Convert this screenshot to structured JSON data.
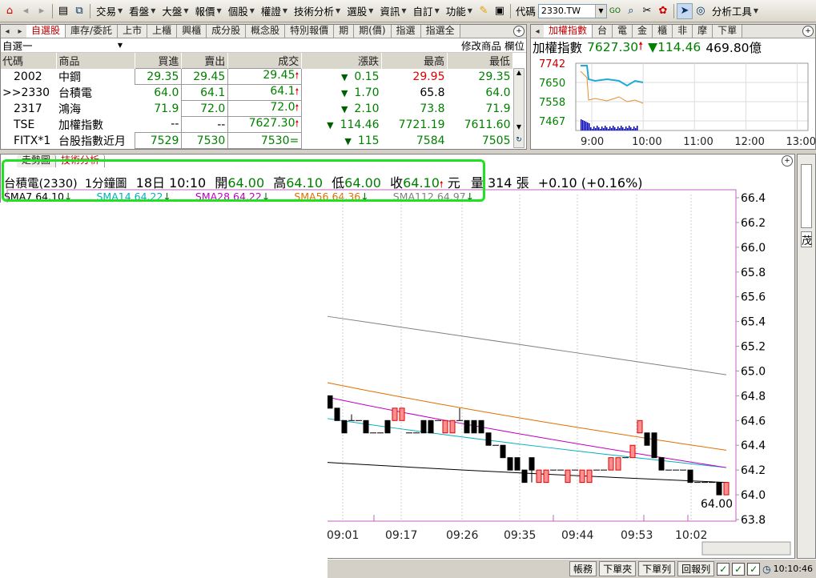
{
  "toolbar": {
    "menus": [
      "交易",
      "看盤",
      "大盤",
      "報價",
      "個股",
      "權證",
      "技術分析",
      "選股",
      "資訊",
      "自訂",
      "功能"
    ],
    "code_label": "代碼",
    "code_value": "2330.TW",
    "tools_label": "分析工具"
  },
  "watch": {
    "tabs": [
      "自選股",
      "庫存/委託",
      "上市",
      "上櫃",
      "興櫃",
      "成分股",
      "概念股",
      "特別報價",
      "期",
      "期(價)",
      "指選",
      "指選全"
    ],
    "group": "自選一",
    "modify_label": "修改商品",
    "field_label": "欄位",
    "columns": [
      "代碼",
      "商品",
      "買進",
      "賣出",
      "成交",
      "漲跌",
      "最高",
      "最低"
    ],
    "rows": [
      {
        "code": "2002",
        "name": "中鋼",
        "bid": "29.35",
        "ask": "29.45",
        "last": "29.45",
        "chg": "0.15",
        "high": "29.95",
        "low": "29.35"
      },
      {
        "code": ">>2330",
        "name": "台積電",
        "bid": "64.0",
        "ask": "64.1",
        "last": "64.1",
        "chg": "1.70",
        "high": "65.8",
        "low": "64.0"
      },
      {
        "code": "2317",
        "name": "鴻海",
        "bid": "71.9",
        "ask": "72.0",
        "last": "72.0",
        "chg": "2.10",
        "high": "73.8",
        "low": "71.9"
      },
      {
        "code": "TSE",
        "name": "加權指數",
        "bid": "--",
        "ask": "--",
        "last": "7627.30",
        "chg": "114.46",
        "high": "7721.19",
        "low": "7611.60"
      },
      {
        "code": "FITX*1",
        "name": "台股指數近月",
        "bid": "7529",
        "ask": "7530",
        "last": "7530=",
        "chg": "115",
        "high": "7584",
        "low": "7505"
      }
    ]
  },
  "mini": {
    "tabs": [
      "加權指數",
      "台",
      "電",
      "金",
      "櫃",
      "非",
      "摩",
      "下單"
    ],
    "index_name": "加權指數",
    "index_value": "7627.30",
    "index_change": "114.46",
    "volume": "469.80億",
    "y_ticks": [
      "7742",
      "7650",
      "7558",
      "7467"
    ],
    "x_ticks": [
      "9:00",
      "10:00",
      "11:00",
      "12:00",
      "13:00"
    ]
  },
  "chart": {
    "tabs": [
      "走勢圖",
      "技術分析"
    ],
    "stock": "台積電(2330)",
    "period": "1分鐘圖",
    "date_time": "18日 10:10",
    "open_label": "開",
    "open": "64.00",
    "high_label": "高",
    "high": "64.10",
    "low_label": "低",
    "low": "64.00",
    "close_label": "收",
    "close": "64.10",
    "unit": "元",
    "vol_label": "量",
    "vol": "314",
    "vol_unit": "張",
    "change": "+0.10 (+0.16%)",
    "sma": [
      {
        "label": "SMA7 64.10",
        "color": "#000000"
      },
      {
        "label": "SMA14 64.22",
        "color": "#00b0c0"
      },
      {
        "label": "SMA28 64.22",
        "color": "#c000c0"
      },
      {
        "label": "SMA56 64.36",
        "color": "#e07000"
      },
      {
        "label": "SMA112 64.97",
        "color": "#808080"
      }
    ],
    "last_price_label": "64.00",
    "side_label": "茂"
  },
  "chart_data": {
    "type": "candlestick",
    "y_ticks": [
      66.4,
      66.2,
      66.0,
      65.8,
      65.6,
      65.4,
      65.2,
      65.0,
      64.8,
      64.6,
      64.4,
      64.2,
      64.0,
      63.8
    ],
    "ylim": [
      63.8,
      66.4
    ],
    "x_ticks": [
      "09:01",
      "09:17",
      "09:26",
      "09:35",
      "09:44",
      "09:53",
      "10:02"
    ],
    "candles": [
      {
        "o": 64.8,
        "c": 64.7,
        "h": 64.8,
        "l": 64.7
      },
      {
        "o": 64.7,
        "c": 64.6,
        "h": 64.7,
        "l": 64.6
      },
      {
        "o": 64.6,
        "c": 64.5,
        "h": 64.6,
        "l": 64.5
      },
      {
        "o": 64.6,
        "c": 64.6,
        "h": 64.65,
        "l": 64.6
      },
      {
        "o": 64.6,
        "c": 64.6,
        "h": 64.6,
        "l": 64.6
      },
      {
        "o": 64.6,
        "c": 64.5,
        "h": 64.6,
        "l": 64.5
      },
      {
        "o": 64.5,
        "c": 64.5,
        "h": 64.5,
        "l": 64.5
      },
      {
        "o": 64.5,
        "c": 64.5,
        "h": 64.5,
        "l": 64.5
      },
      {
        "o": 64.6,
        "c": 64.5,
        "h": 64.6,
        "l": 64.5
      },
      {
        "o": 64.6,
        "c": 64.7,
        "h": 64.7,
        "l": 64.6
      },
      {
        "o": 64.6,
        "c": 64.7,
        "h": 64.7,
        "l": 64.6
      },
      {
        "o": 64.5,
        "c": 64.5,
        "h": 64.5,
        "l": 64.5
      },
      {
        "o": 64.5,
        "c": 64.5,
        "h": 64.5,
        "l": 64.5
      },
      {
        "o": 64.6,
        "c": 64.5,
        "h": 64.6,
        "l": 64.5
      },
      {
        "o": 64.6,
        "c": 64.5,
        "h": 64.6,
        "l": 64.5
      },
      {
        "o": 64.6,
        "c": 64.6,
        "h": 64.6,
        "l": 64.6
      },
      {
        "o": 64.5,
        "c": 64.6,
        "h": 64.6,
        "l": 64.5
      },
      {
        "o": 64.5,
        "c": 64.6,
        "h": 64.6,
        "l": 64.5
      },
      {
        "o": 64.6,
        "c": 64.6,
        "h": 64.7,
        "l": 64.6
      },
      {
        "o": 64.6,
        "c": 64.5,
        "h": 64.6,
        "l": 64.5
      },
      {
        "o": 64.6,
        "c": 64.5,
        "h": 64.6,
        "l": 64.5
      },
      {
        "o": 64.6,
        "c": 64.5,
        "h": 64.6,
        "l": 64.5
      },
      {
        "o": 64.5,
        "c": 64.4,
        "h": 64.5,
        "l": 64.4
      },
      {
        "o": 64.4,
        "c": 64.4,
        "h": 64.4,
        "l": 64.4
      },
      {
        "o": 64.4,
        "c": 64.3,
        "h": 64.4,
        "l": 64.3
      },
      {
        "o": 64.3,
        "c": 64.2,
        "h": 64.3,
        "l": 64.2
      },
      {
        "o": 64.3,
        "c": 64.2,
        "h": 64.3,
        "l": 64.2
      },
      {
        "o": 64.2,
        "c": 64.1,
        "h": 64.2,
        "l": 64.1
      },
      {
        "o": 64.3,
        "c": 64.2,
        "h": 64.3,
        "l": 64.1
      },
      {
        "o": 64.1,
        "c": 64.2,
        "h": 64.2,
        "l": 64.1
      },
      {
        "o": 64.1,
        "c": 64.2,
        "h": 64.2,
        "l": 64.1
      },
      {
        "o": 64.2,
        "c": 64.2,
        "h": 64.2,
        "l": 64.2
      },
      {
        "o": 64.2,
        "c": 64.2,
        "h": 64.2,
        "l": 64.2
      },
      {
        "o": 64.1,
        "c": 64.2,
        "h": 64.2,
        "l": 64.1
      },
      {
        "o": 64.2,
        "c": 64.2,
        "h": 64.2,
        "l": 64.2
      },
      {
        "o": 64.1,
        "c": 64.2,
        "h": 64.2,
        "l": 64.1
      },
      {
        "o": 64.1,
        "c": 64.2,
        "h": 64.2,
        "l": 64.1
      },
      {
        "o": 64.2,
        "c": 64.2,
        "h": 64.2,
        "l": 64.2
      },
      {
        "o": 64.2,
        "c": 64.2,
        "h": 64.2,
        "l": 64.2
      },
      {
        "o": 64.2,
        "c": 64.3,
        "h": 64.3,
        "l": 64.2
      },
      {
        "o": 64.2,
        "c": 64.3,
        "h": 64.3,
        "l": 64.2
      },
      {
        "o": 64.3,
        "c": 64.3,
        "h": 64.3,
        "l": 64.3
      },
      {
        "o": 64.3,
        "c": 64.4,
        "h": 64.4,
        "l": 64.3
      },
      {
        "o": 64.5,
        "c": 64.6,
        "h": 64.6,
        "l": 64.5
      },
      {
        "o": 64.5,
        "c": 64.4,
        "h": 64.5,
        "l": 64.4
      },
      {
        "o": 64.5,
        "c": 64.3,
        "h": 64.5,
        "l": 64.3
      },
      {
        "o": 64.3,
        "c": 64.2,
        "h": 64.3,
        "l": 64.2
      },
      {
        "o": 64.2,
        "c": 64.2,
        "h": 64.2,
        "l": 64.2
      },
      {
        "o": 64.2,
        "c": 64.2,
        "h": 64.2,
        "l": 64.2
      },
      {
        "o": 64.2,
        "c": 64.2,
        "h": 64.2,
        "l": 64.2
      },
      {
        "o": 64.2,
        "c": 64.1,
        "h": 64.2,
        "l": 64.1
      },
      {
        "o": 64.1,
        "c": 64.1,
        "h": 64.1,
        "l": 64.1
      },
      {
        "o": 64.1,
        "c": 64.1,
        "h": 64.1,
        "l": 64.1
      },
      {
        "o": 64.1,
        "c": 64.1,
        "h": 64.1,
        "l": 64.1
      },
      {
        "o": 64.1,
        "c": 64.0,
        "h": 64.1,
        "l": 64.0
      },
      {
        "o": 64.0,
        "c": 64.1,
        "h": 64.1,
        "l": 64.0
      }
    ],
    "sma_series": [
      {
        "name": "SMA7",
        "color": "#000000",
        "y_from": 64.52,
        "y_to": 64.1
      },
      {
        "name": "SMA14",
        "color": "#00b0c0",
        "y_from": 65.25,
        "y_to": 64.22
      },
      {
        "name": "SMA28",
        "color": "#c000c0",
        "y_from": 65.7,
        "y_to": 64.22
      },
      {
        "name": "SMA56",
        "color": "#e07000",
        "y_from": 65.78,
        "y_to": 64.36
      },
      {
        "name": "SMA112",
        "color": "#808080",
        "y_from": 65.82,
        "y_to": 64.97
      }
    ]
  },
  "status": {
    "buttons": [
      "帳務",
      "下單夾",
      "下單列",
      "回報列"
    ],
    "time": "10:10:46"
  }
}
